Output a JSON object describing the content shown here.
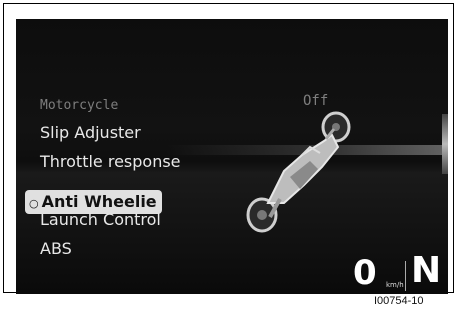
{
  "header": {
    "label": "Motorcycle",
    "value": "Off"
  },
  "menu": {
    "items": [
      {
        "label": "Slip Adjuster"
      },
      {
        "label": "Throttle response"
      },
      {
        "label": "Anti Wheelie",
        "selected": true
      },
      {
        "label": "Launch Control"
      },
      {
        "label": "ABS"
      }
    ]
  },
  "status": {
    "speed": "0",
    "unit": "km/h",
    "gear": "N"
  },
  "figure_ref": "I00754-10",
  "colors": {
    "screen_bg": "#0d0d0d",
    "selected_bg": "#e0e0e0",
    "text": "#e8e8e8",
    "dim_text": "#7e7e7e"
  },
  "icons": {
    "selected_marker": "pointer-icon"
  }
}
